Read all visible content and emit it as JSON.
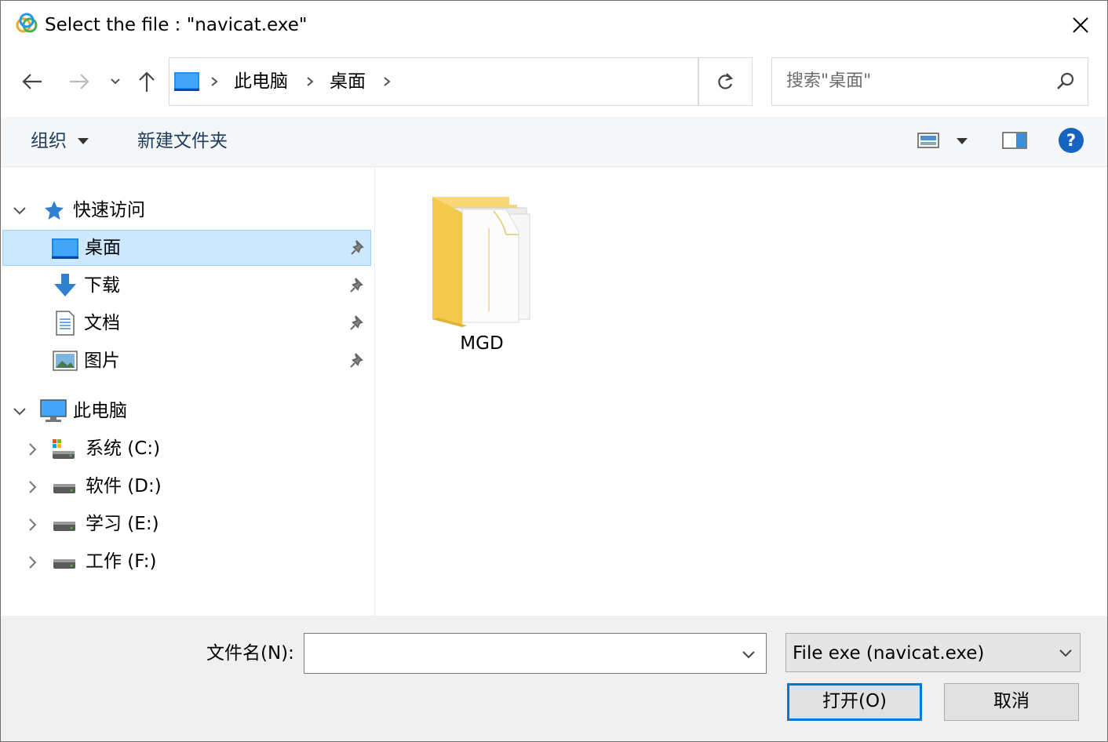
{
  "window": {
    "title": "Select the file : \"navicat.exe\"",
    "app_icon": "navicat-icon",
    "close_icon": "close-icon"
  },
  "nav": {
    "back_icon": "arrow-left-icon",
    "forward_icon": "arrow-right-icon",
    "recent_icon": "chevron-down-icon",
    "up_icon": "arrow-up-icon",
    "refresh_icon": "refresh-icon"
  },
  "address": {
    "root_icon": "desktop-icon",
    "crumbs": [
      "此电脑",
      "桌面"
    ]
  },
  "search": {
    "placeholder": "搜索\"桌面\"",
    "icon": "search-icon"
  },
  "toolbar": {
    "organize": "组织",
    "new_folder": "新建文件夹",
    "view_icon": "view-mode-icon",
    "preview_icon": "preview-pane-icon",
    "help_icon": "help-icon"
  },
  "navpane": {
    "quick_access": {
      "label": "快速访问",
      "items": [
        {
          "label": "桌面",
          "icon": "desktop-icon",
          "selected": true
        },
        {
          "label": "下载",
          "icon": "download-icon"
        },
        {
          "label": "文档",
          "icon": "document-icon"
        },
        {
          "label": "图片",
          "icon": "picture-icon"
        }
      ]
    },
    "this_pc": {
      "label": "此电脑",
      "drives": [
        {
          "label": "系统 (C:)",
          "icon": "system-drive-icon"
        },
        {
          "label": "软件 (D:)",
          "icon": "drive-icon"
        },
        {
          "label": "学习 (E:)",
          "icon": "drive-icon"
        },
        {
          "label": "工作 (F:)",
          "icon": "drive-icon"
        }
      ]
    }
  },
  "content": {
    "items": [
      {
        "name": "MGD",
        "type": "folder"
      }
    ]
  },
  "bottom": {
    "filename_label": "文件名(N):",
    "filename_value": "",
    "filter": "File exe (navicat.exe)",
    "open_button": "打开(O)",
    "cancel_button": "取消"
  },
  "colors": {
    "selection_bg": "#cce8ff",
    "selection_border": "#99d1ff",
    "accent": "#0078d7",
    "folder_yellow": "#ffd76a"
  }
}
